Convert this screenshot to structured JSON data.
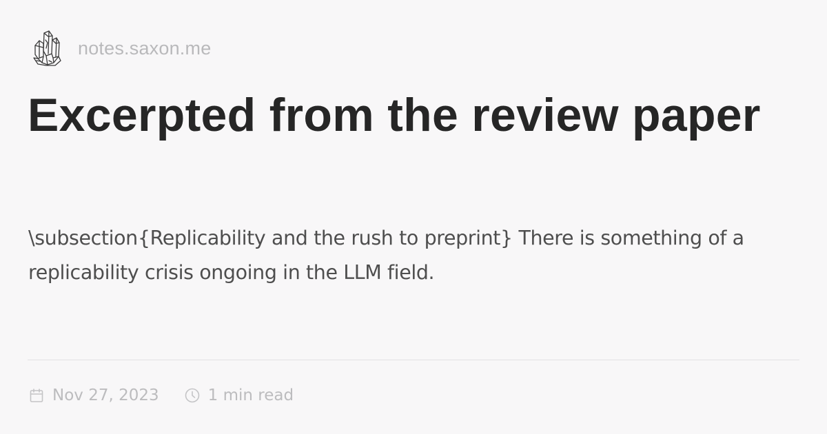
{
  "site": {
    "name": "notes.saxon.me",
    "logo_icon": "crystal-cluster-logo"
  },
  "post": {
    "title": "Excerpted from the review paper",
    "excerpt": "\\subsection{Replicability and the rush to preprint} There is something of a replicability crisis ongoing in the LLM field.",
    "date": "Nov 27, 2023",
    "reading_time": "1 min read"
  },
  "icons": {
    "date": "calendar-icon",
    "reading_time": "clock-icon"
  },
  "colors": {
    "background": "#f8f7f8",
    "title": "#262626",
    "excerpt": "#4e4e4e",
    "muted": "#bcbcbe",
    "divider": "#e2e1e3"
  }
}
